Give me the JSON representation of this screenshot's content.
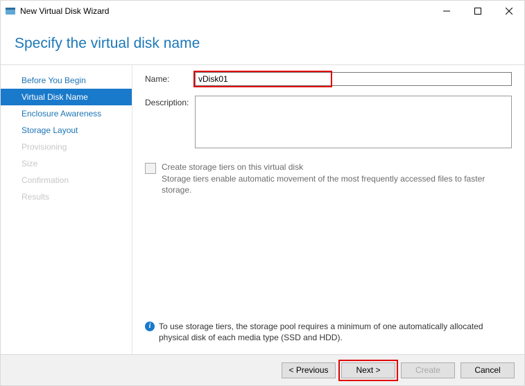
{
  "titlebar": {
    "title": "New Virtual Disk Wizard"
  },
  "heading": "Specify the virtual disk name",
  "steps": [
    {
      "label": "Before You Begin",
      "state": "link"
    },
    {
      "label": "Virtual Disk Name",
      "state": "selected"
    },
    {
      "label": "Enclosure Awareness",
      "state": "link"
    },
    {
      "label": "Storage Layout",
      "state": "link"
    },
    {
      "label": "Provisioning",
      "state": "disabled"
    },
    {
      "label": "Size",
      "state": "disabled"
    },
    {
      "label": "Confirmation",
      "state": "disabled"
    },
    {
      "label": "Results",
      "state": "disabled"
    }
  ],
  "form": {
    "name_label": "Name:",
    "name_value": "vDisk01",
    "desc_label": "Description:",
    "desc_value": "",
    "tiers_checkbox_label": "Create storage tiers on this virtual disk",
    "tiers_help": "Storage tiers enable automatic movement of the most frequently accessed files to faster storage."
  },
  "info_text": "To use storage tiers, the storage pool requires a minimum of one automatically allocated physical disk of each media type (SSD and HDD).",
  "buttons": {
    "previous": "< Previous",
    "next": "Next >",
    "create": "Create",
    "cancel": "Cancel"
  }
}
